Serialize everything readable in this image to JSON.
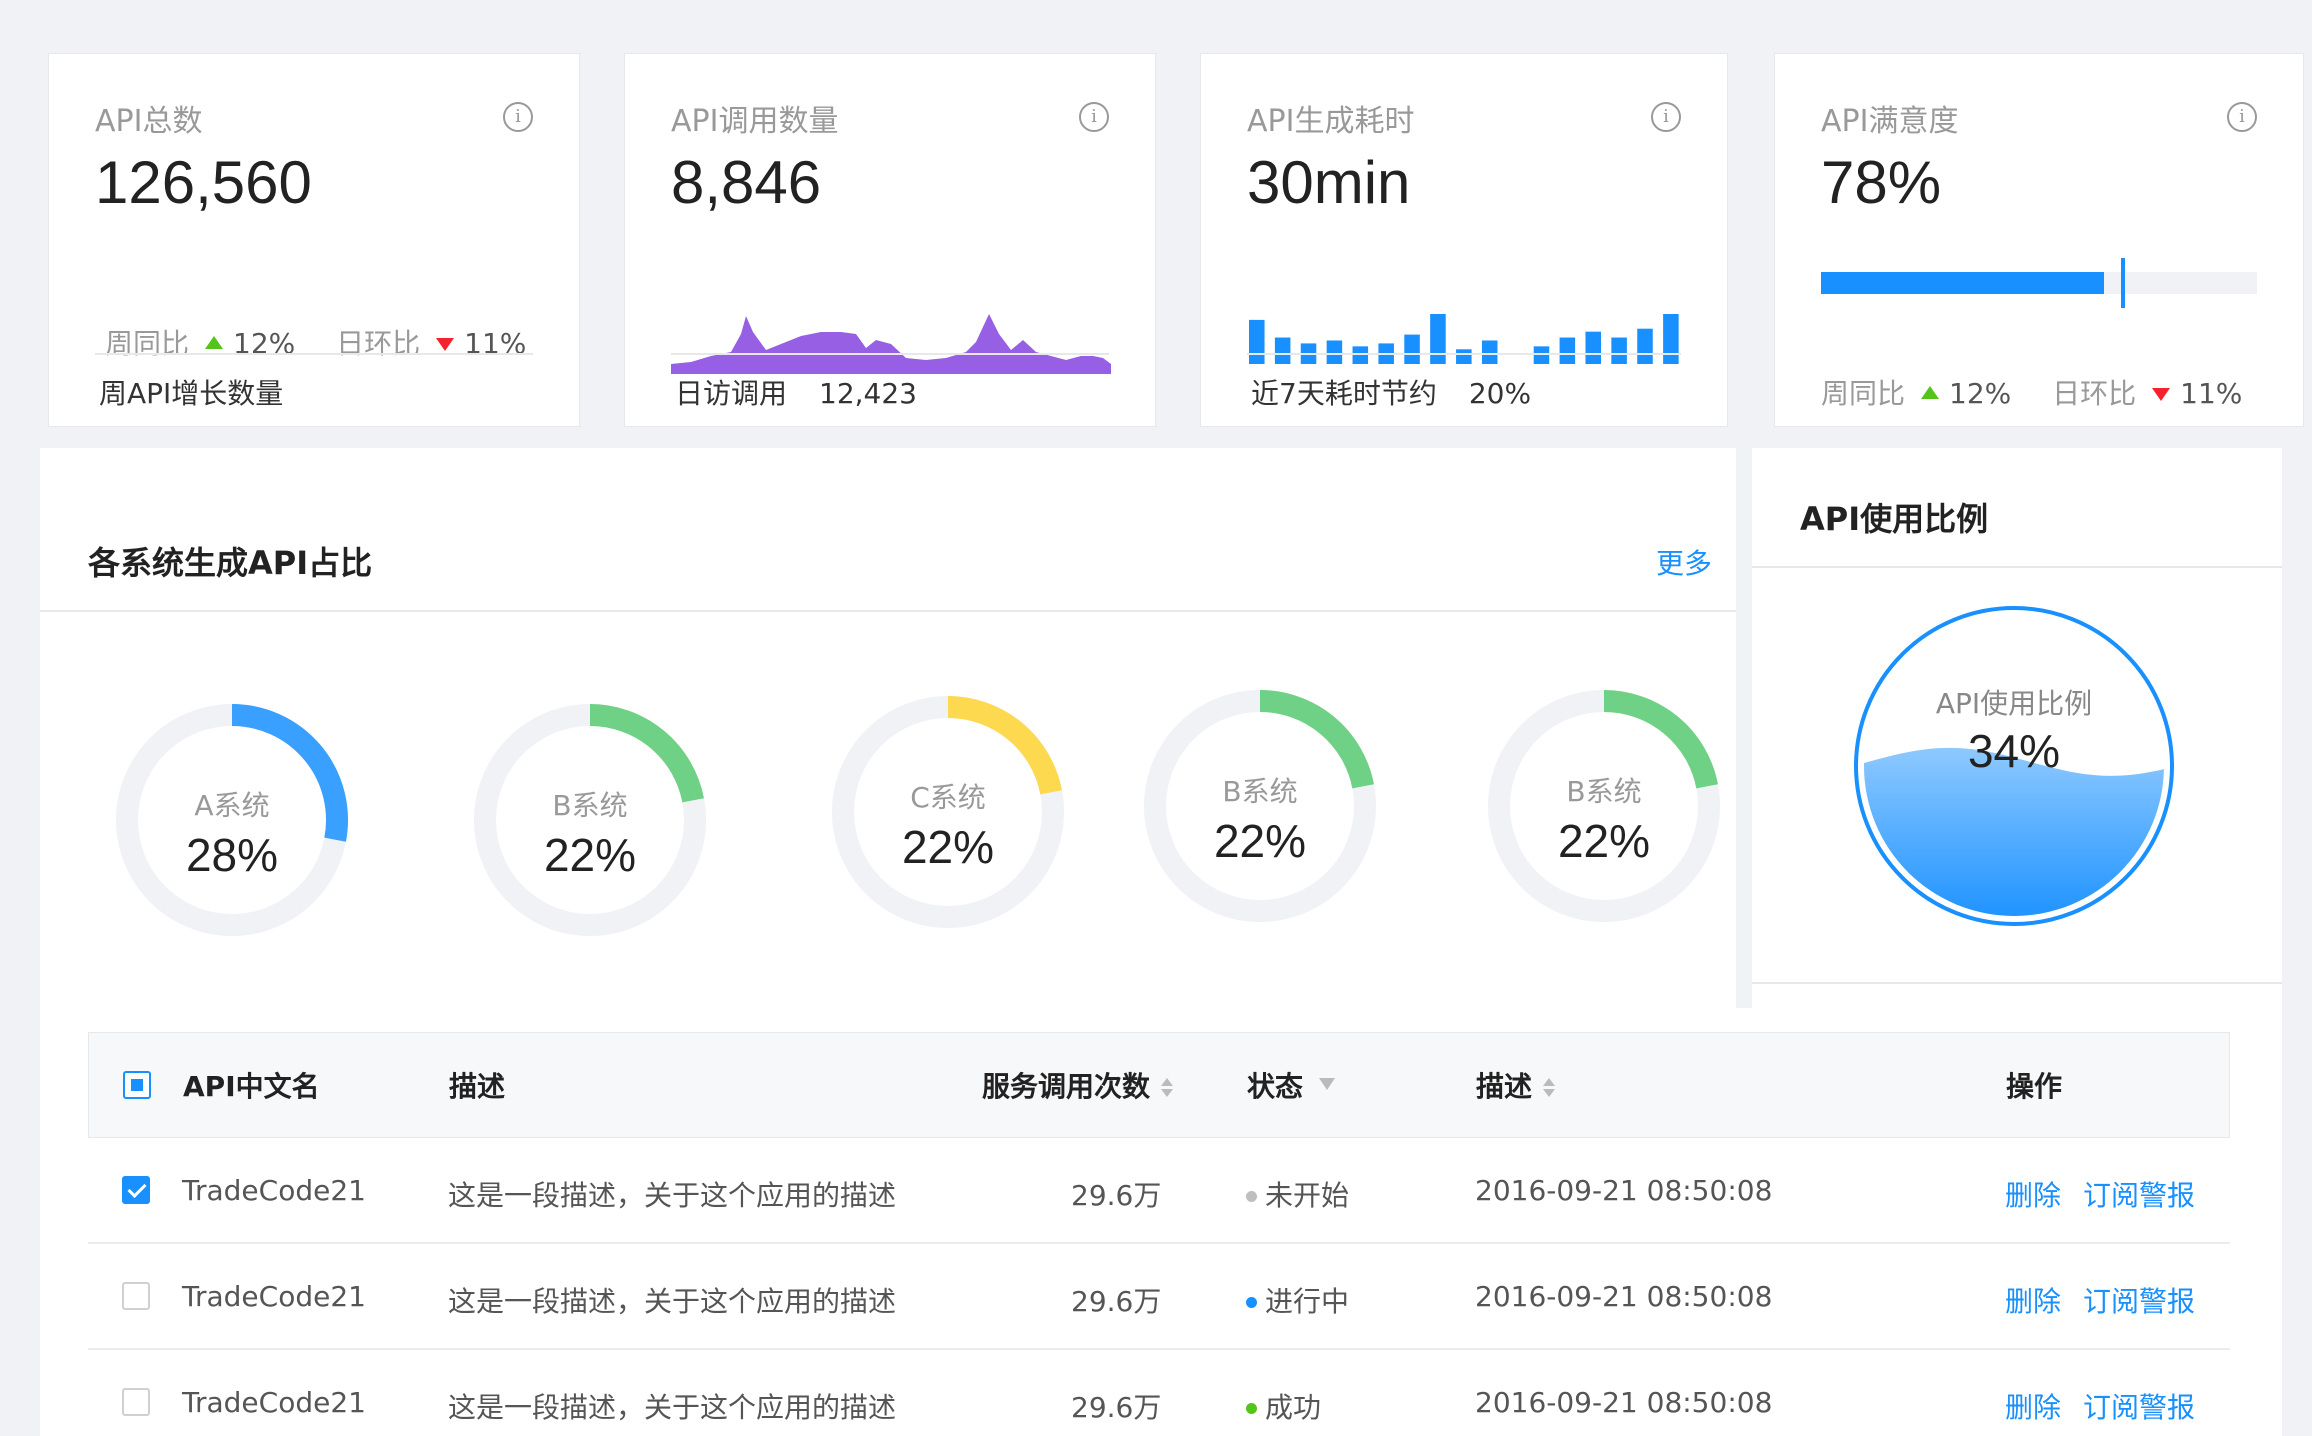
{
  "cards": [
    {
      "label": "API总数",
      "value": "126,560",
      "wow_label": "周同比",
      "wow_value": "12%",
      "dod_label": "日环比",
      "dod_value": "11%",
      "footer": "周API增长数量"
    },
    {
      "label": "API调用数量",
      "value": "8,846",
      "footer_label": "日访调用",
      "footer_value": "12,423"
    },
    {
      "label": "API生成耗时",
      "value": "30min",
      "footer_label": "近7天耗时节约",
      "footer_value": "20%"
    },
    {
      "label": "API满意度",
      "value": "78%",
      "progress": 0.65,
      "wow_label": "周同比",
      "wow_value": "12%",
      "dod_label": "日环比",
      "dod_value": "11%"
    }
  ],
  "info_glyph": "i",
  "bar_values": [
    30,
    18,
    14,
    16,
    12,
    14,
    20,
    34,
    10,
    16,
    0,
    12,
    18,
    22,
    18,
    24,
    34
  ],
  "systems": {
    "title": "各系统生成API占比",
    "more": "更多",
    "donuts": [
      {
        "name": "A系统",
        "value": "28%",
        "pct": 0.28,
        "color": "#3aa0ff"
      },
      {
        "name": "B系统",
        "value": "22%",
        "pct": 0.22,
        "color": "#6fd186"
      },
      {
        "name": "C系统",
        "value": "22%",
        "pct": 0.22,
        "color": "#fcd94e"
      },
      {
        "name": "B系统",
        "value": "22%",
        "pct": 0.22,
        "color": "#6fd186"
      },
      {
        "name": "B系统",
        "value": "22%",
        "pct": 0.22,
        "color": "#6fd186"
      }
    ]
  },
  "usage": {
    "title": "API使用比例",
    "label": "API使用比例",
    "value": "34%",
    "pct": 0.34
  },
  "table": {
    "headers": {
      "name": "API中文名",
      "desc": "描述",
      "calls": "服务调用次数",
      "status": "状态",
      "desc2": "描述",
      "ops": "操作"
    },
    "rows": [
      {
        "checked": true,
        "name": "TradeCode21",
        "desc": "这是一段描述，关于这个应用的描述",
        "calls": "29.6万",
        "status": "未开始",
        "status_color": "#bfbfbf",
        "time": "2016-09-21  08:50:08",
        "op1": "删除",
        "op2": "订阅警报"
      },
      {
        "checked": false,
        "name": "TradeCode21",
        "desc": "这是一段描述，关于这个应用的描述",
        "calls": "29.6万",
        "status": "进行中",
        "status_color": "#1890ff",
        "time": "2016-09-21  08:50:08",
        "op1": "删除",
        "op2": "订阅警报"
      },
      {
        "checked": false,
        "name": "TradeCode21",
        "desc": "这是一段描述，关于这个应用的描述",
        "calls": "29.6万",
        "status": "成功",
        "status_color": "#52c41a",
        "time": "2016-09-21  08:50:08",
        "op1": "删除",
        "op2": "订阅警报"
      }
    ]
  }
}
